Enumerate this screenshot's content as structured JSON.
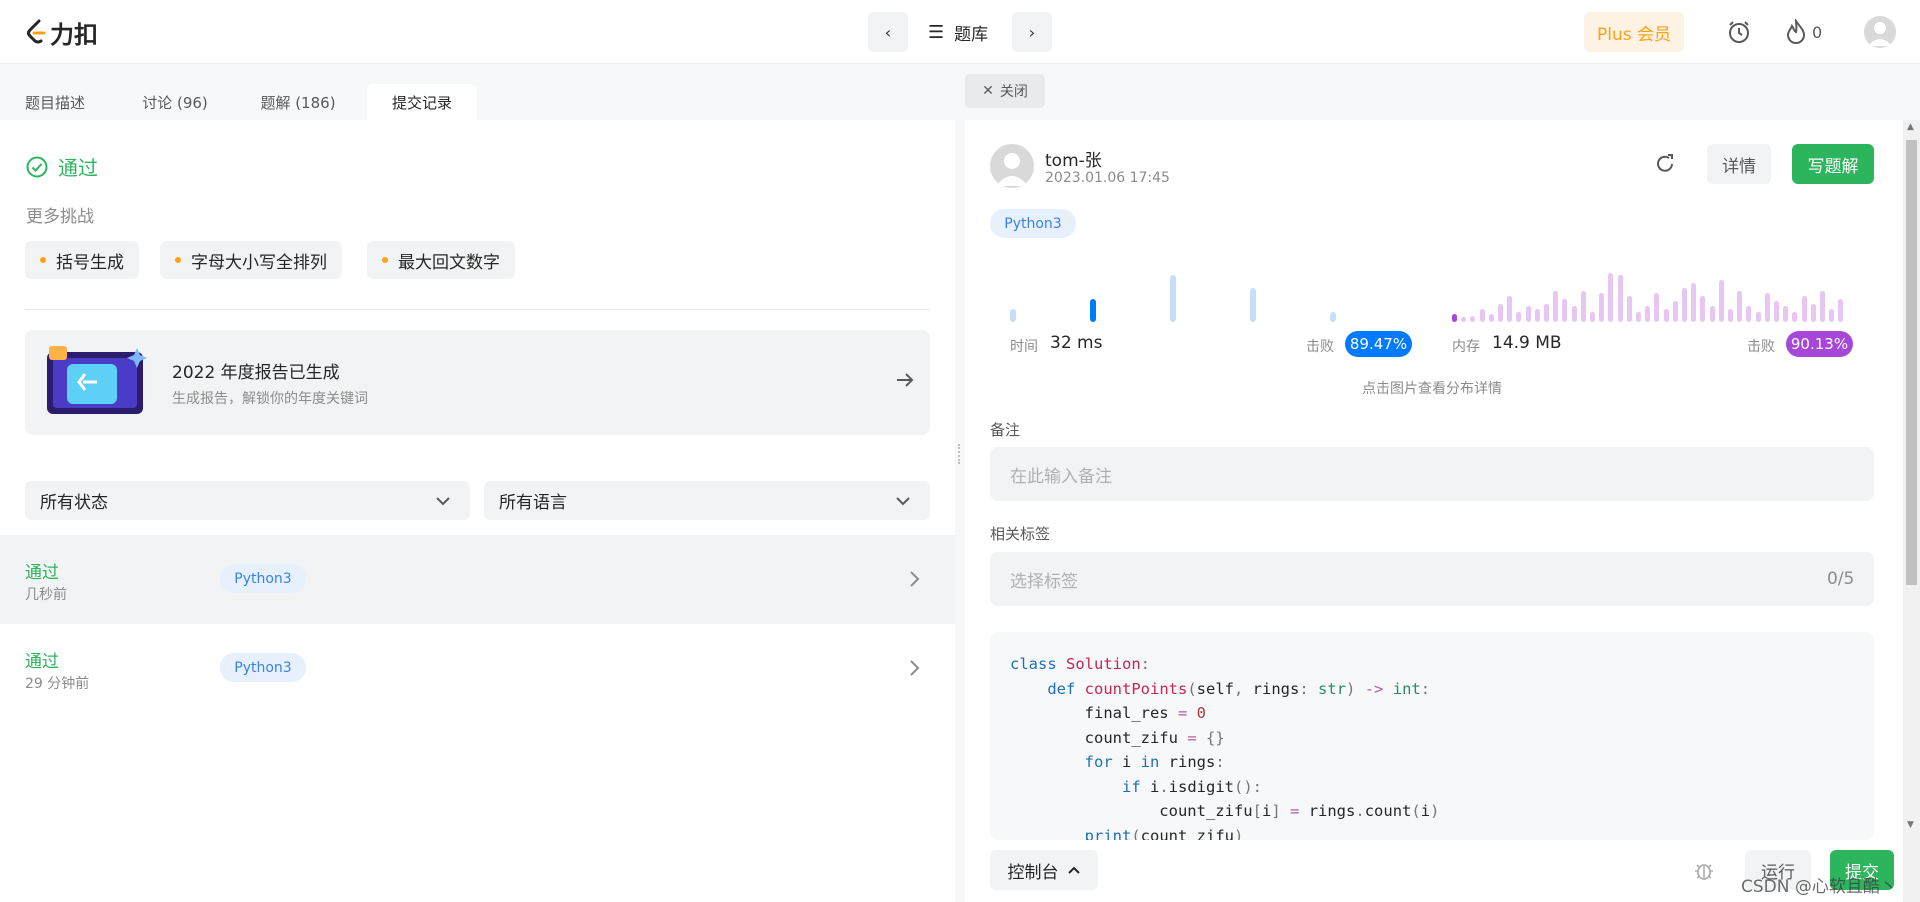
{
  "nav": {
    "logo_text": "力扣",
    "problem_bank": "题库",
    "plus_label": "Plus 会员",
    "streak_count": "0"
  },
  "tabs": [
    {
      "label": "题目描述"
    },
    {
      "label": "讨论 (96)"
    },
    {
      "label": "题解 (186)"
    },
    {
      "label": "提交记录"
    }
  ],
  "left": {
    "status": "通过",
    "more_challenges": "更多挑战",
    "challenges": [
      "括号生成",
      "字母大小写全排列",
      "最大回文数字"
    ],
    "banner": {
      "title": "2022 年度报告已生成",
      "subtitle": "生成报告，解锁你的年度关键词"
    },
    "filter_status": "所有状态",
    "filter_language": "所有语言",
    "submissions": [
      {
        "status": "通过",
        "time": "几秒前",
        "lang": "Python3"
      },
      {
        "status": "通过",
        "time": "29 分钟前",
        "lang": "Python3"
      }
    ]
  },
  "right": {
    "close_label": "关闭",
    "user": "tom-张",
    "datetime": "2023.01.06 17:45",
    "details_btn": "详情",
    "write_solution_btn": "写题解",
    "lang_badge": "Python3",
    "runtime_label": "时间",
    "runtime_value": "32 ms",
    "runtime_beats_label": "击败",
    "runtime_beats_value": "89.47%",
    "runtime_beats_pct": 89.47,
    "memory_label": "内存",
    "memory_value": "14.9 MB",
    "memory_beats_label": "击败",
    "memory_beats_value": "90.13%",
    "memory_beats_pct": 90.13,
    "chart_hint": "点击图片查看分布详情",
    "note_label": "备注",
    "note_placeholder": "在此输入备注",
    "tags_label": "相关标签",
    "tags_placeholder": "选择标签",
    "tags_count": "0/5",
    "console_btn": "控制台",
    "run_btn": "运行",
    "submit_btn": "提交",
    "watermark": "CSDN @心软且酷丶"
  },
  "colors": {
    "green": "#2db55d",
    "blue": "#007aff",
    "purple": "#a647d9",
    "orange": "#ffa116"
  },
  "runtime_bars": [
    0.25,
    0.45,
    0.9,
    0.65,
    0.2
  ],
  "memory_bars": [
    0.15,
    0.1,
    0.12,
    0.25,
    0.15,
    0.35,
    0.5,
    0.2,
    0.3,
    0.25,
    0.35,
    0.6,
    0.45,
    0.3,
    0.6,
    0.2,
    0.55,
    0.95,
    0.9,
    0.5,
    0.2,
    0.3,
    0.55,
    0.25,
    0.4,
    0.65,
    0.75,
    0.5,
    0.3,
    0.8,
    0.25,
    0.6,
    0.3,
    0.2,
    0.55,
    0.4,
    0.3,
    0.2,
    0.5,
    0.35,
    0.6,
    0.25,
    0.45
  ]
}
